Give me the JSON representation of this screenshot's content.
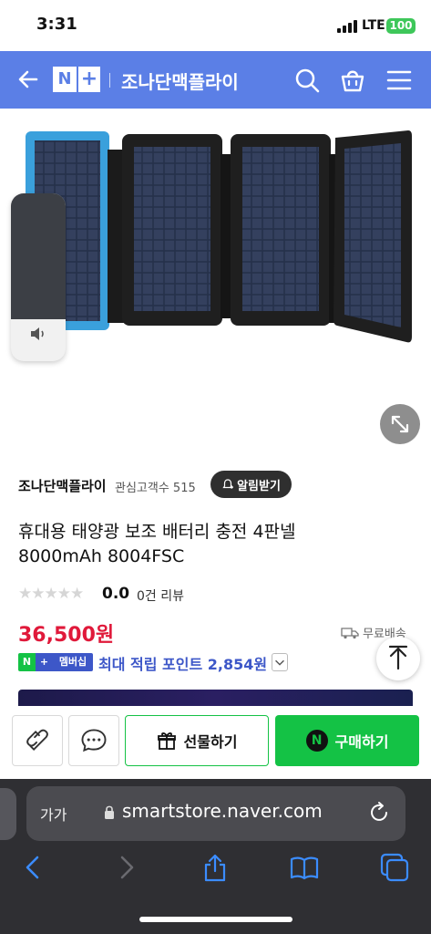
{
  "status_bar": {
    "time": "3:31",
    "network": "LTE",
    "battery": "100"
  },
  "header": {
    "logo_n": "N",
    "logo_plus": "+",
    "store_name": "조나단맥플라이"
  },
  "store": {
    "seller_name": "조나단맥플라이",
    "followers": "관심고객수 515",
    "alarm_label": "알림받기"
  },
  "product": {
    "title_line1": "휴대용 태양광 보조 배터리 충전 4판넬",
    "title_line2": "8000mAh 8004FSC",
    "stars": "★★★★★",
    "rating": "0.0",
    "review_count": "0건 리뷰",
    "price": "36,500원",
    "shipping": "무료배송"
  },
  "membership": {
    "n": "N",
    "plus": "+",
    "label": "멤버십",
    "points": "최대 적립 포인트 2,854원"
  },
  "actions": {
    "gift_label": "선물하기",
    "buy_n": "N",
    "buy_label": "구매하기"
  },
  "safari": {
    "text_size": "가가",
    "url": "smartstore.naver.com"
  },
  "colors": {
    "header_blue": "#5b7fe6",
    "price_red": "#e0193a",
    "naver_green": "#14c245",
    "points_blue": "#3d57c8"
  },
  "icons": [
    "back-icon",
    "search-icon",
    "cart-icon",
    "menu-icon",
    "expand-icon",
    "speaker-icon",
    "bell-icon",
    "truck-icon",
    "chevron-down-icon",
    "arrow-up-icon",
    "share-icon",
    "chat-icon",
    "gift-icon",
    "lock-icon",
    "reload-icon",
    "safari-back-icon",
    "safari-forward-icon",
    "share-sheet-icon",
    "bookmarks-icon",
    "tabs-icon"
  ]
}
